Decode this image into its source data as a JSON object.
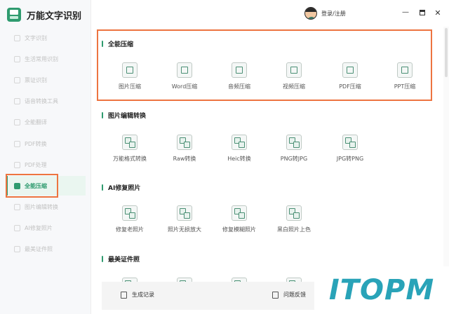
{
  "app": {
    "title": "万能文字识别"
  },
  "header": {
    "login": "登录/注册",
    "minimize": "—",
    "close": "✕"
  },
  "sidebar": {
    "items": [
      {
        "label": "文字识别"
      },
      {
        "label": "生活常用识别"
      },
      {
        "label": "票证识别"
      },
      {
        "label": "语音转换工具"
      },
      {
        "label": "全能翻译"
      },
      {
        "label": "PDF转换"
      },
      {
        "label": "PDF处理"
      },
      {
        "label": "全能压缩"
      },
      {
        "label": "图片编辑转换"
      },
      {
        "label": "AI修复照片"
      },
      {
        "label": "最美证件照"
      }
    ],
    "active_index": 7
  },
  "sections": [
    {
      "title": "全能压缩",
      "tools": [
        {
          "label": "图片压缩"
        },
        {
          "label": "Word压缩"
        },
        {
          "label": "音频压缩"
        },
        {
          "label": "视频压缩"
        },
        {
          "label": "PDF压缩"
        },
        {
          "label": "PPT压缩"
        }
      ]
    },
    {
      "title": "图片编辑转换",
      "tools": [
        {
          "label": "万能格式转换"
        },
        {
          "label": "Raw转换"
        },
        {
          "label": "Heic转换"
        },
        {
          "label": "PNG转JPG"
        },
        {
          "label": "JPG转PNG"
        }
      ]
    },
    {
      "title": "AI修复照片",
      "tools": [
        {
          "label": "修复老照片"
        },
        {
          "label": "照片无损放大"
        },
        {
          "label": "修复模糊照片"
        },
        {
          "label": "黑白照片上色"
        }
      ]
    },
    {
      "title": "最美证件照",
      "tools": []
    }
  ],
  "bottom": {
    "records": "生成记录",
    "feedback": "问题反馈"
  },
  "watermark": {
    "text": "ITOPM"
  }
}
